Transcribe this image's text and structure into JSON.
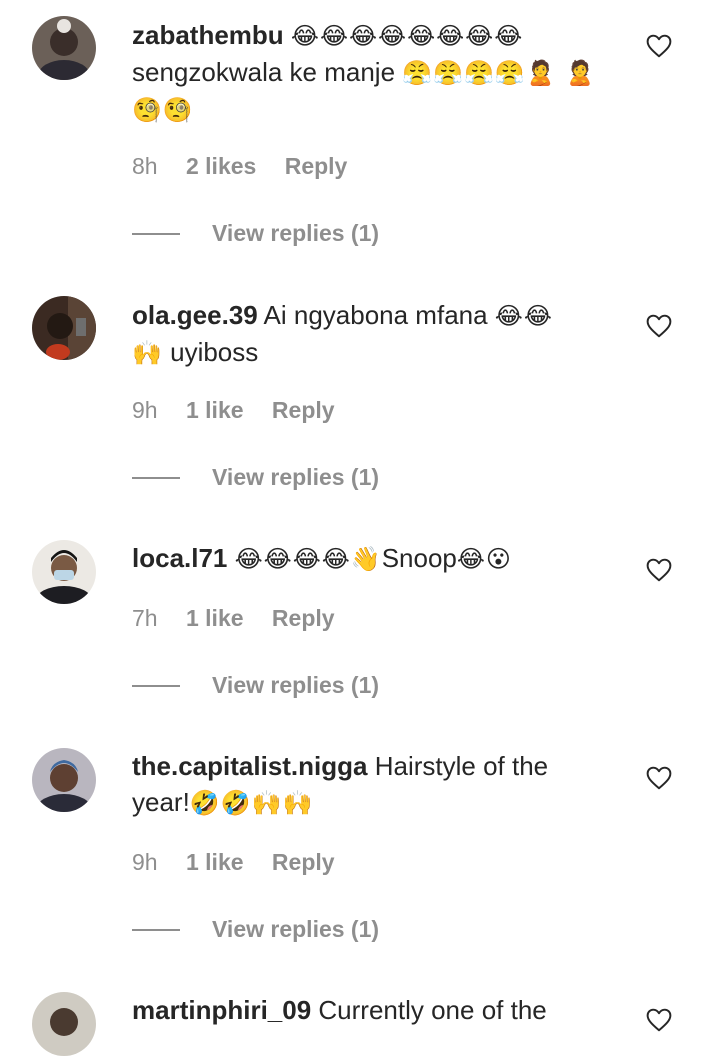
{
  "comments": [
    {
      "username": "zabathembu",
      "text_part1": "",
      "emoji1": "😂😂😂😂😂😂😂😂",
      "text_part2": "sengzokwala ke manje ",
      "emoji2": "😤😤😤😤🙎 🙎🧐🧐",
      "time": "8h",
      "likes": "2 likes",
      "reply": "Reply",
      "view_replies": "View replies (1)"
    },
    {
      "username": "ola.gee.39",
      "text_part1": " Ai ngyabona mfana ",
      "emoji1": "😂😂",
      "emoji2": "🙌",
      "text_part2": " uyiboss",
      "time": "9h",
      "likes": "1 like",
      "reply": "Reply",
      "view_replies": "View replies (1)"
    },
    {
      "username": "loca.l71",
      "emoji1": "😂😂😂😂👋",
      "text_part1": "Snoop",
      "emoji2": "😂😮",
      "time": "7h",
      "likes": "1 like",
      "reply": "Reply",
      "view_replies": "View replies (1)"
    },
    {
      "username": "the.capitalist.nigga",
      "text_part1": " Hairstyle of the year!",
      "emoji1": "🤣🤣🙌🙌",
      "time": "9h",
      "likes": "1 like",
      "reply": "Reply",
      "view_replies": "View replies (1)"
    },
    {
      "username": "martinphiri_09",
      "text_part1": " Currently one of the"
    }
  ],
  "icons": {
    "heart": "heart-outline-icon"
  },
  "colors": {
    "text": "#262626",
    "secondary": "#8e8e8e"
  }
}
